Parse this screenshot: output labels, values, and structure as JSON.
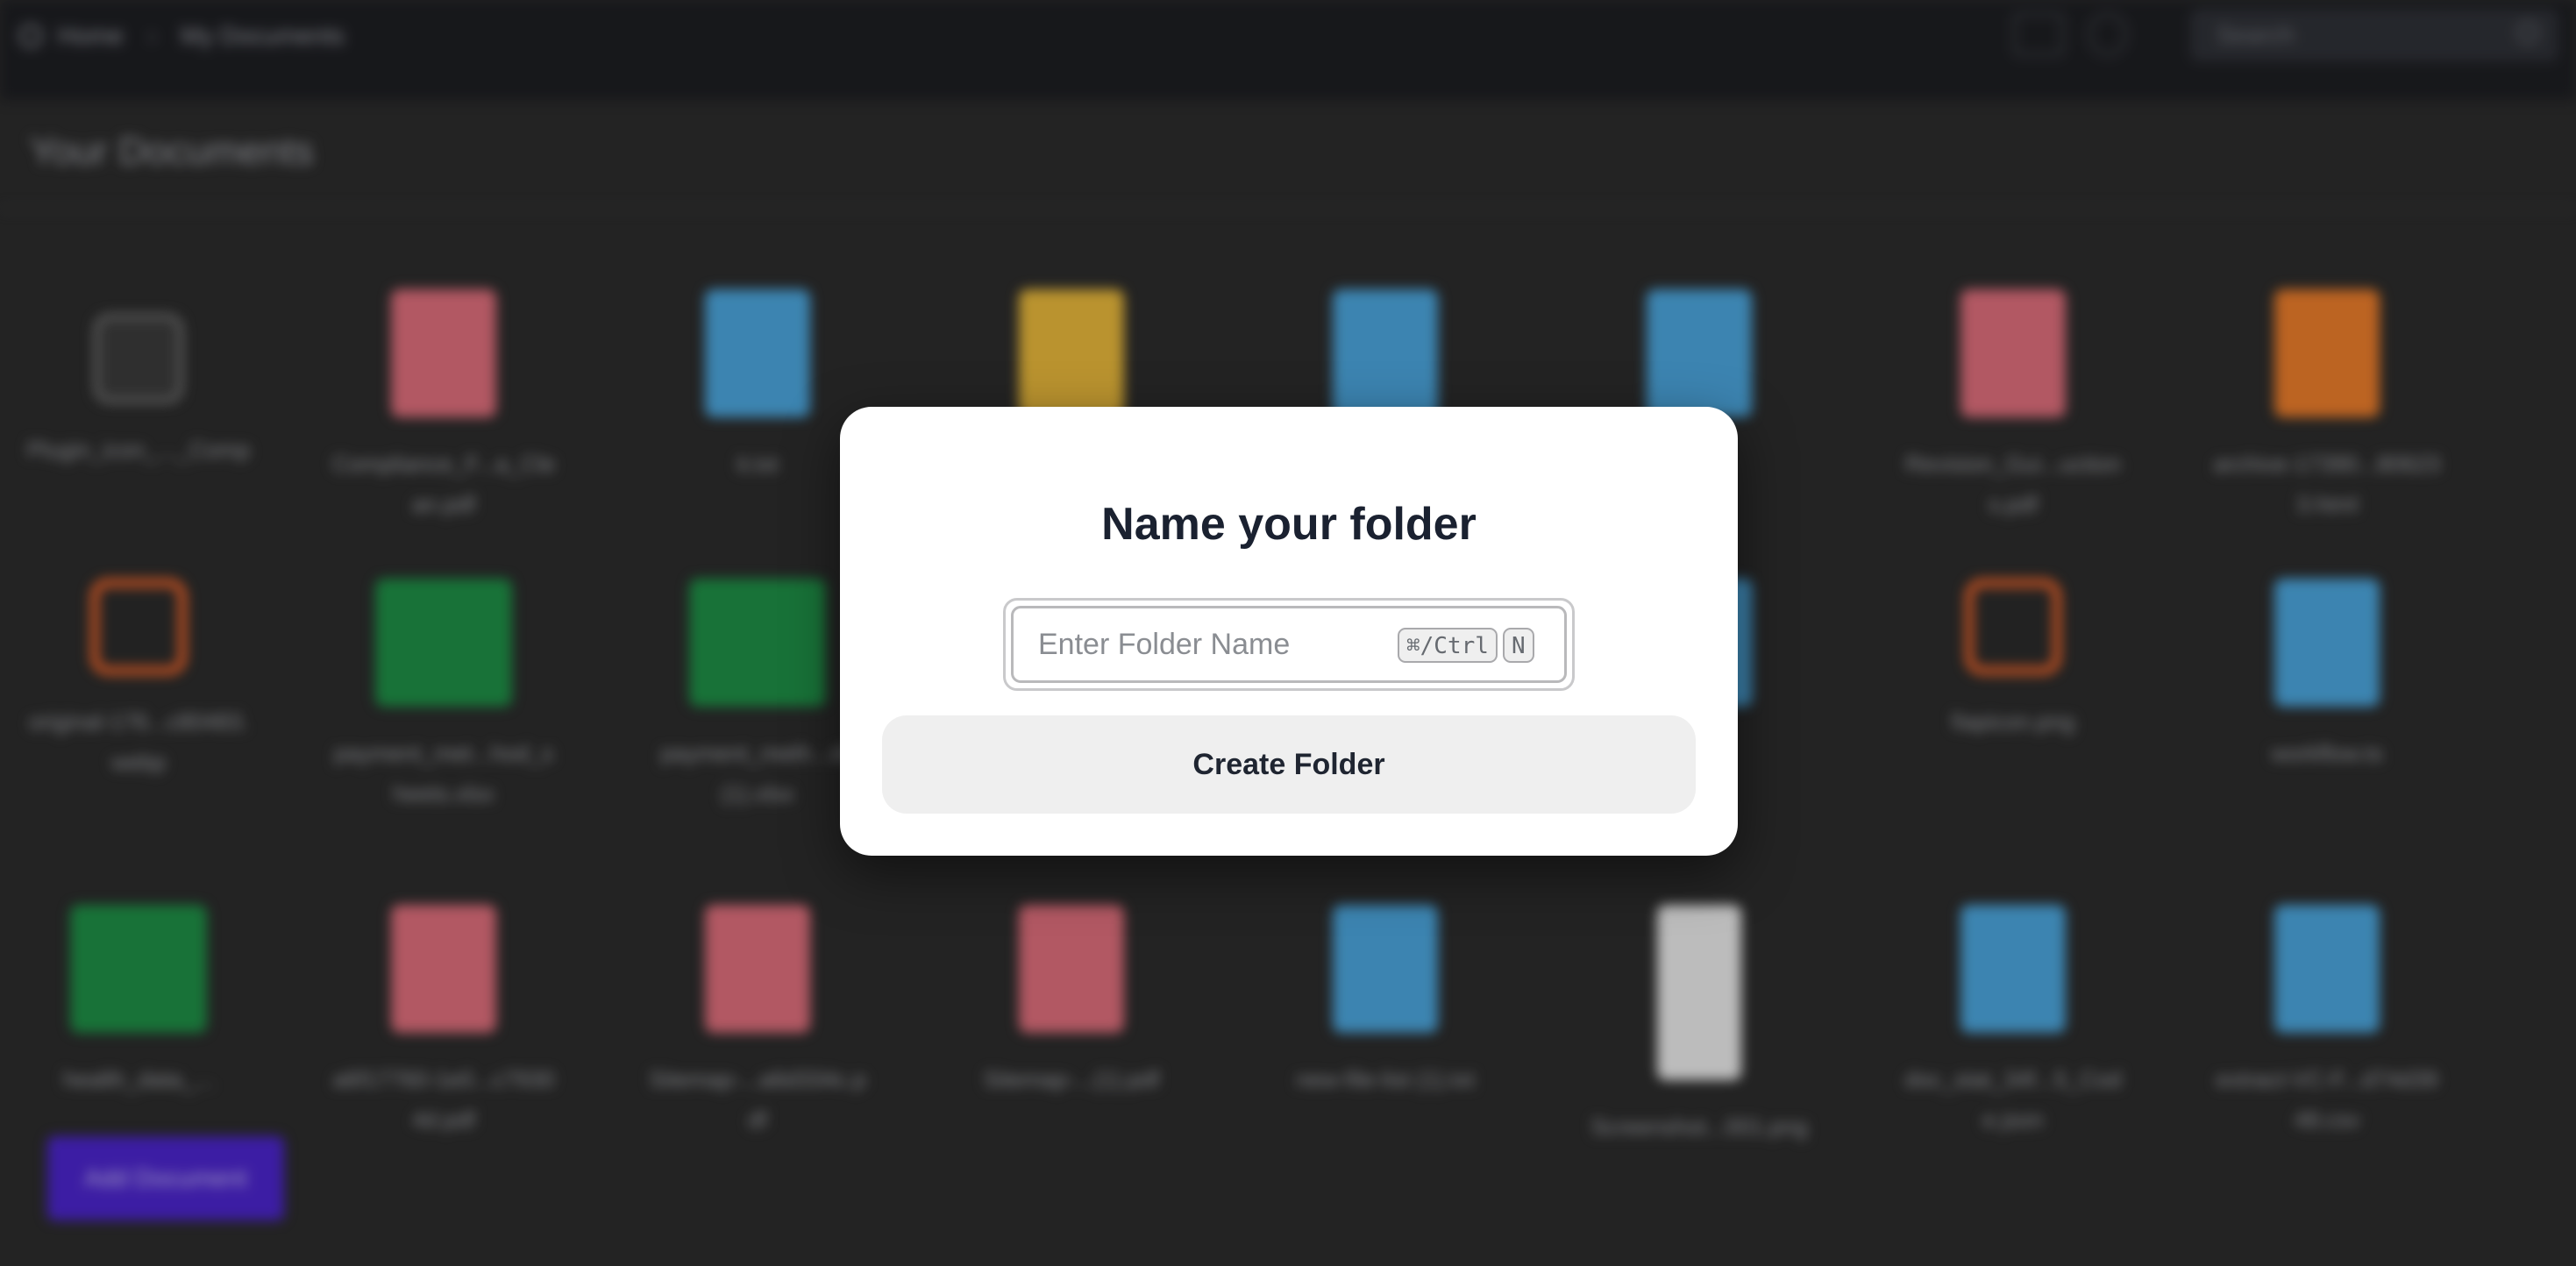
{
  "header": {
    "breadcrumb": [
      "Home",
      "My Documents"
    ],
    "search_placeholder": "Search"
  },
  "main": {
    "title": "Your Documents",
    "files": [
      {
        "name": "Plugin_icon_..._Comp",
        "kind": "app"
      },
      {
        "name": "Compliance_F...a_Clean.pdf",
        "kind": "pdf"
      },
      {
        "name": "it.txt",
        "kind": "doc"
      },
      {
        "name": "",
        "kind": "zip"
      },
      {
        "name": "",
        "kind": "doc"
      },
      {
        "name": "",
        "kind": "doc"
      },
      {
        "name": "Revision_Gui...uctions.pdf",
        "kind": "pdf"
      },
      {
        "name": "archive-17390...806233.html",
        "kind": "html"
      },
      {
        "name": "original-176...c80483.webp",
        "kind": "image"
      },
      {
        "name": "payment_met...hod_sheets.xlsx",
        "kind": "excel"
      },
      {
        "name": "payment_meth...ds (1).xlsx",
        "kind": "excel"
      },
      {
        "name": "",
        "kind": "doc"
      },
      {
        "name": "",
        "kind": "doc"
      },
      {
        "name": "",
        "kind": "doc"
      },
      {
        "name": "fiapicon.png",
        "kind": "image"
      },
      {
        "name": "workflow.ts",
        "kind": "doc"
      },
      {
        "name": "health_data_...",
        "kind": "excel"
      },
      {
        "name": "a6f17760-1e0...c79304d.pdf",
        "kind": "pdf"
      },
      {
        "name": "Sitemap-...a6d334c.pdf",
        "kind": "pdf"
      },
      {
        "name": "Sitemap-...(1).pdf",
        "kind": "pdf"
      },
      {
        "name": "new-file-list (1).txt",
        "kind": "doc"
      },
      {
        "name": "Screenshot...001.png",
        "kind": "photo"
      },
      {
        "name": "doc_stat_34f...5_Code.json",
        "kind": "doc"
      },
      {
        "name": "extract-VC-F...d74d3948.csv",
        "kind": "doc"
      }
    ],
    "add_button": "Add Document"
  },
  "modal": {
    "title": "Name your folder",
    "input_placeholder": "Enter Folder Name",
    "input_value": "",
    "shortcut_modifier": "⌘/Ctrl",
    "shortcut_key": "N",
    "submit_label": "Create Folder"
  },
  "colors": {
    "pdf": "#d96c79",
    "doc": "#4aa2d8",
    "zip": "#e3b43a",
    "excel": "#1e8c45",
    "html": "#e67a2a",
    "app": "#e04a1a",
    "image": "#e8622a",
    "photo": "#e6e6e6",
    "accent": "#4a24c8"
  }
}
